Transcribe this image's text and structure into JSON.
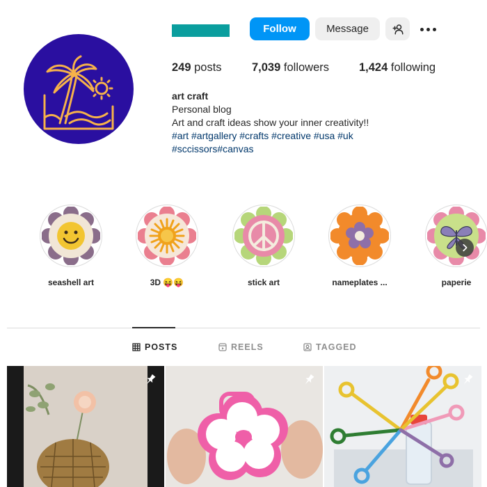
{
  "header": {
    "follow_label": "Follow",
    "message_label": "Message",
    "add_user_icon": "add-person-icon",
    "more_icon": "more-options-icon"
  },
  "stats": {
    "posts_count": "249",
    "posts_label": "posts",
    "followers_count": "7,039",
    "followers_label": "followers",
    "following_count": "1,424",
    "following_label": "following"
  },
  "bio": {
    "name": "art craft",
    "category": "Personal blog",
    "text": "Art and craft ideas show your inner creativity!!",
    "tags_line1": "#art #artgallery #crafts #creative #usa #uk",
    "tags_line2": "#sccissors#canvas"
  },
  "highlights": [
    {
      "label": "seashell art"
    },
    {
      "label": "3D 😝😝"
    },
    {
      "label": "stick art"
    },
    {
      "label": "nameplates ..."
    },
    {
      "label": "paperie"
    }
  ],
  "tabs": [
    {
      "label": "POSTS",
      "icon": "grid-icon",
      "active": true
    },
    {
      "label": "REELS",
      "icon": "reels-icon",
      "active": false
    },
    {
      "label": "TAGGED",
      "icon": "tagged-icon",
      "active": false
    }
  ],
  "colors": {
    "accent": "#0095f6",
    "avatar_bg": "#2a0fa0",
    "hashtag": "#00376b"
  }
}
